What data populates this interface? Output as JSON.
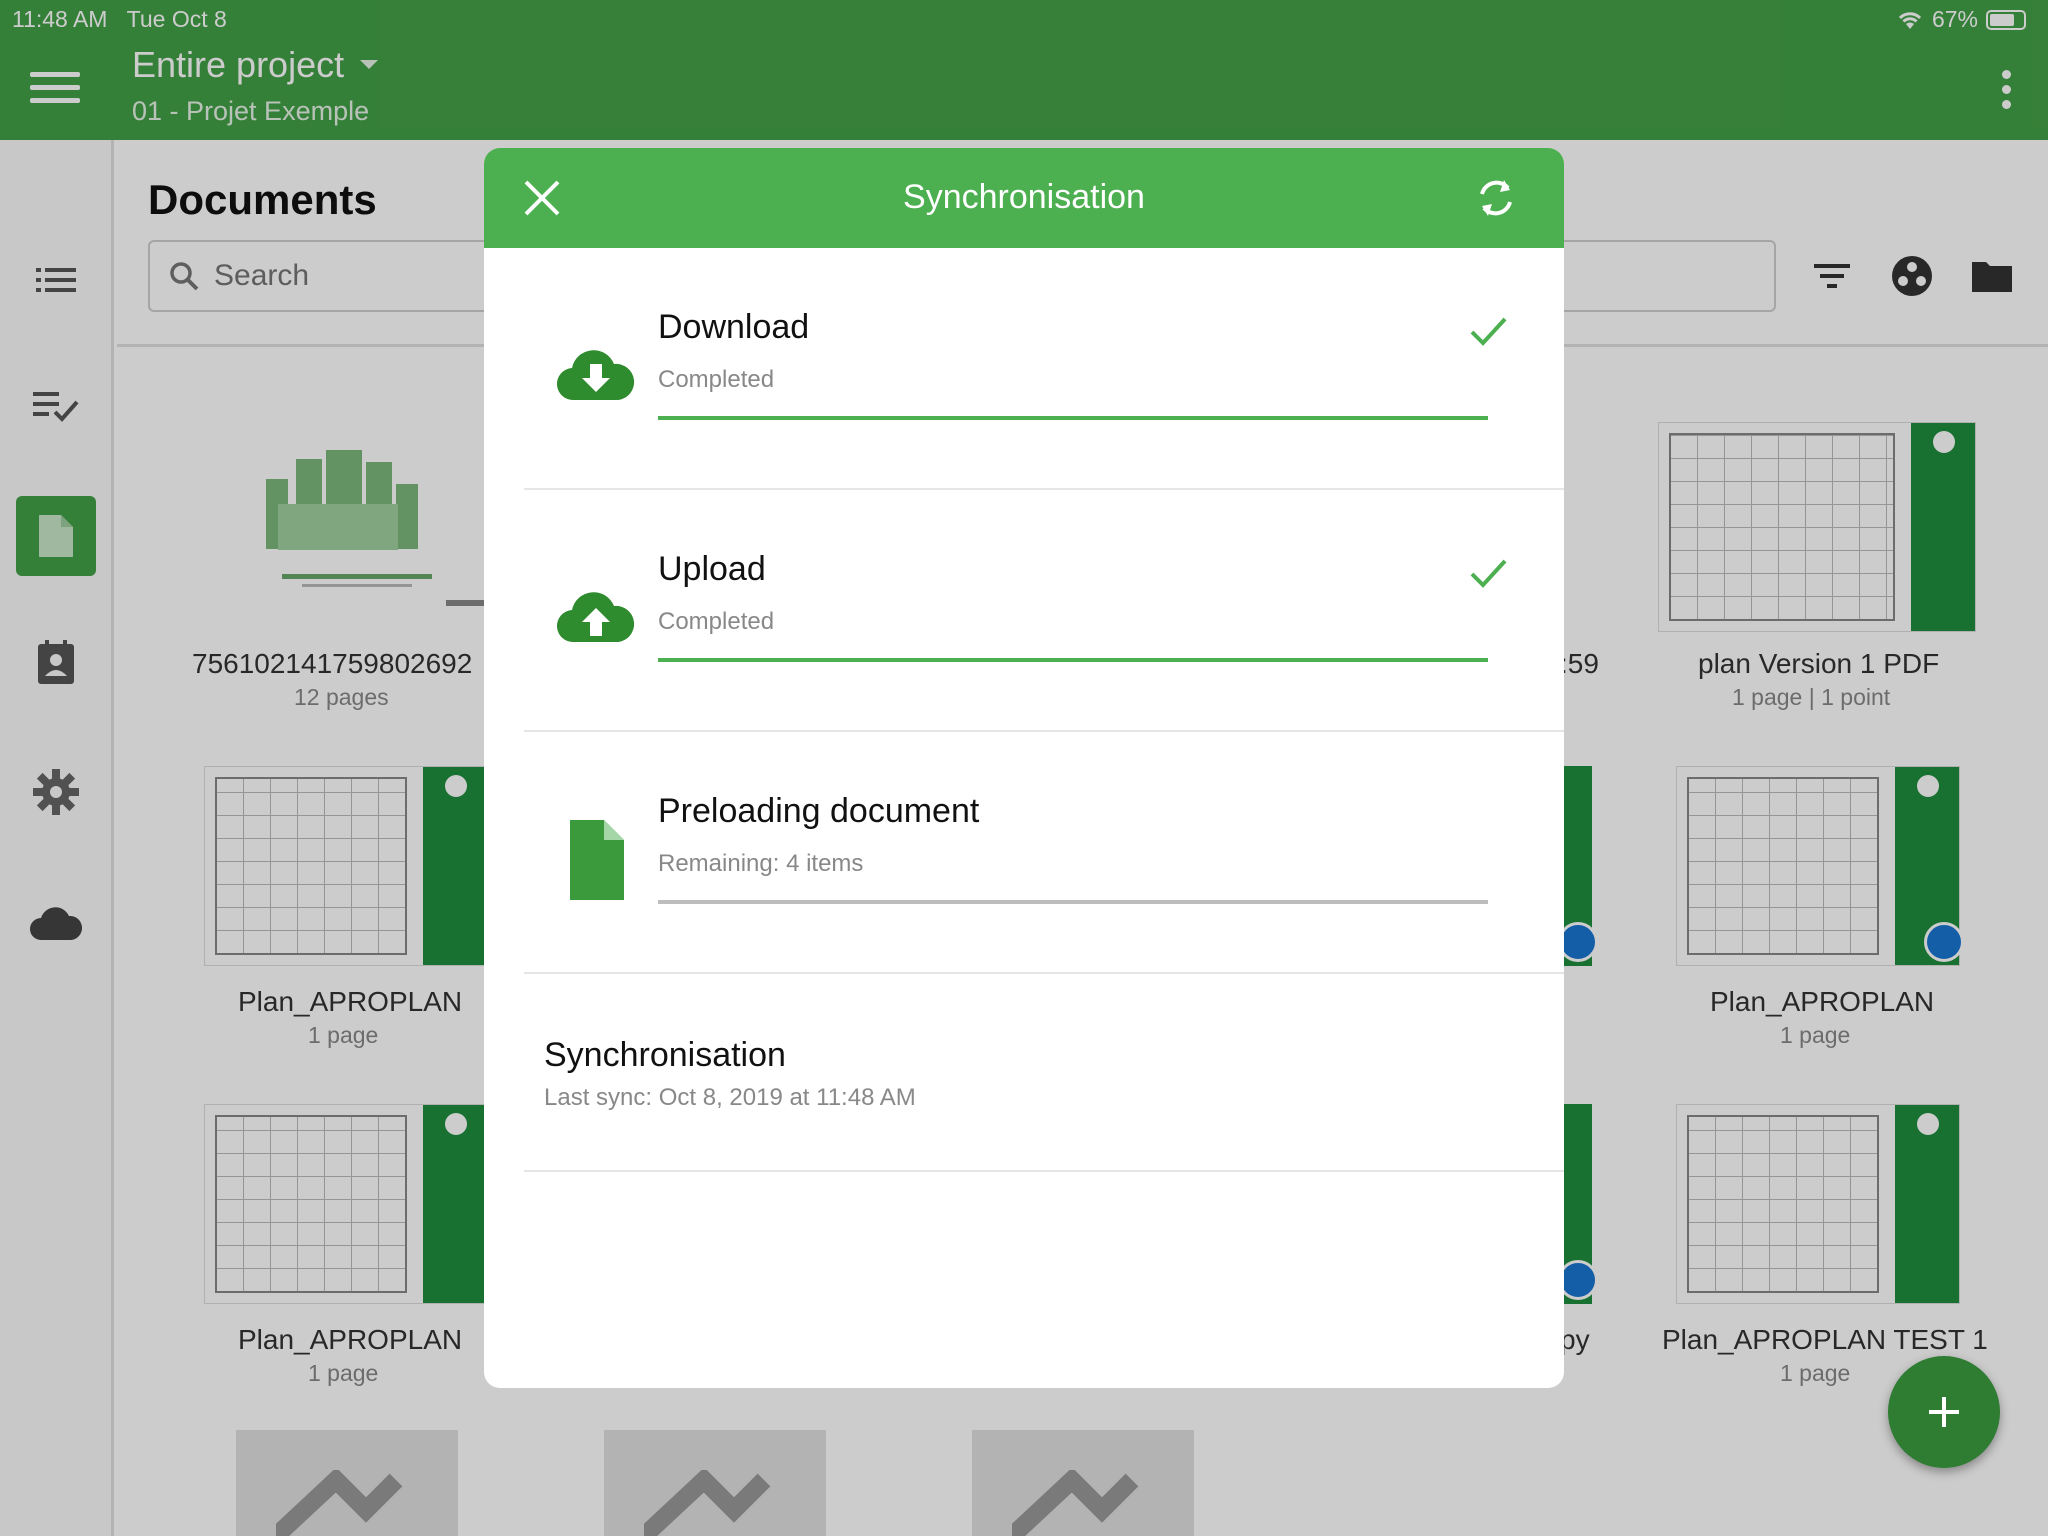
{
  "status_bar": {
    "time": "11:48 AM",
    "date": "Tue Oct 8",
    "battery": "67%"
  },
  "header": {
    "title": "Entire project",
    "subtitle": "01 - Projet Exemple"
  },
  "documents": {
    "title": "Documents",
    "search_placeholder": "Search",
    "items": [
      {
        "name": "756102141759802692",
        "meta": "12 pages"
      },
      {
        "name": "plan Version 1 PDF",
        "meta": "1 page | 1 point"
      },
      {
        "name": "Plan_APROPLAN",
        "meta": "1 page"
      },
      {
        "name": "Plan_APROPLAN",
        "meta": "1 page"
      },
      {
        "name": "Plan_APROPLAN",
        "meta": "1 page"
      },
      {
        "name": "Plan_APROPLAN TEST 1",
        "meta": "1 page"
      }
    ],
    "partial_texts": [
      ":59",
      "py"
    ]
  },
  "sync_modal": {
    "title": "Synchronisation",
    "rows": [
      {
        "title": "Download",
        "status": "Completed",
        "progress": 1.0
      },
      {
        "title": "Upload",
        "status": "Completed",
        "progress": 1.0
      },
      {
        "title": "Preloading document",
        "status": "Remaining: 4 items",
        "progress": 0.0
      }
    ],
    "last_sync_title": "Synchronisation",
    "last_sync_text": "Last sync: Oct 8, 2019 at 11:48 AM"
  },
  "colors": {
    "header_green": "#43a047",
    "modal_header_green": "#4caf50",
    "icon_green": "#2e8b2e",
    "fab_green": "#2e7d32",
    "sync_badge_blue": "#1976d2"
  }
}
